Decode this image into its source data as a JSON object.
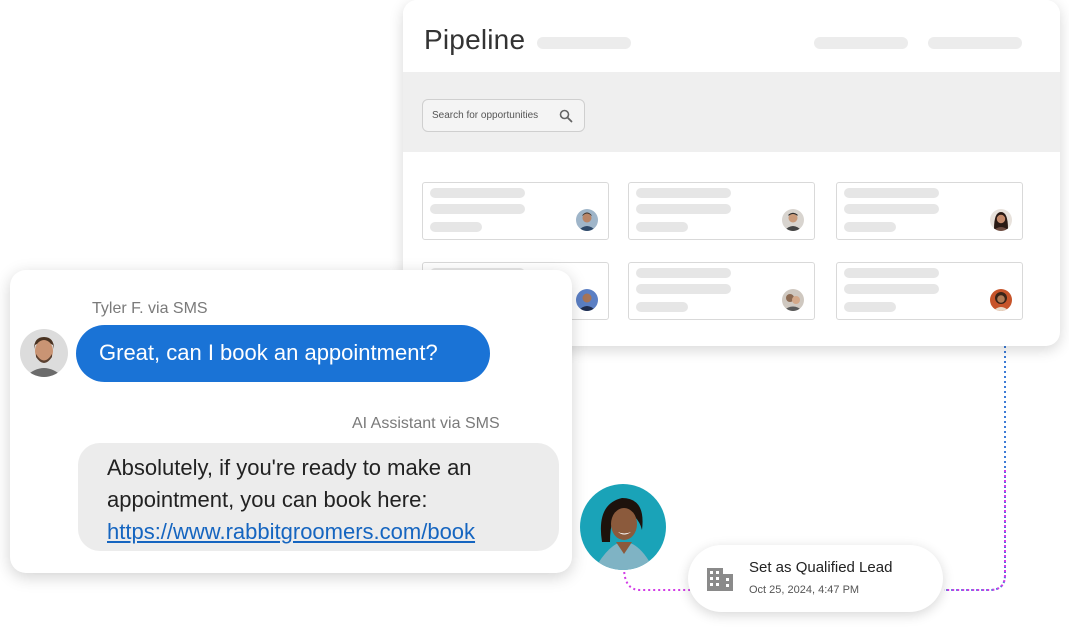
{
  "pipeline": {
    "title": "Pipeline",
    "search_placeholder": "Search for opportunities",
    "search_icon": "search-icon"
  },
  "chat": {
    "incoming_sender": "Tyler F. via SMS",
    "incoming_message": "Great, can I book an appointment?",
    "reply_sender": "AI Assistant via SMS",
    "reply_line1": "Absolutely, if you're ready to make an",
    "reply_line2": "appointment, you can book here:",
    "reply_link": "https://www.rabbitgroomers.com/book"
  },
  "notification": {
    "title": "Set as Qualified Lead",
    "timestamp": "Oct 25, 2024, 4:47 PM",
    "icon": "building-icon"
  },
  "colors": {
    "accent_blue": "#1a73d6",
    "link_blue": "#1565c0",
    "connector_blue": "#3b7bd6",
    "connector_magenta": "#d23be6",
    "agent_bg": "#1aa3b8"
  }
}
